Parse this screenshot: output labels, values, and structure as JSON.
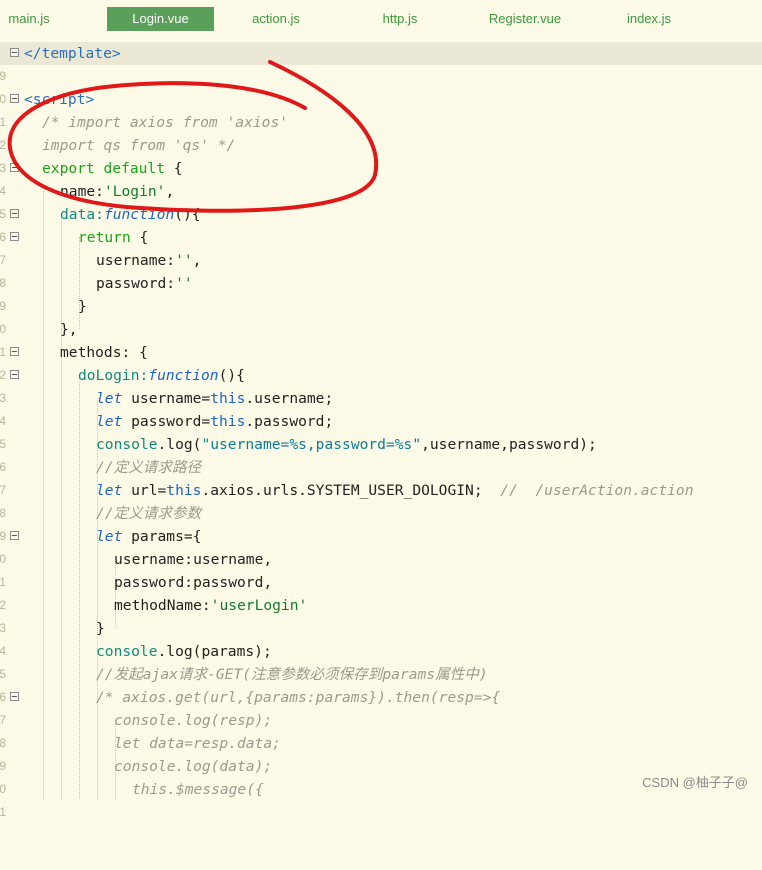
{
  "tabs": [
    {
      "label": "main.js"
    },
    {
      "label": "Login.vue"
    },
    {
      "label": "action.js"
    },
    {
      "label": "http.js"
    },
    {
      "label": "Register.vue"
    },
    {
      "label": "index.js"
    }
  ],
  "active_tab": "Login.vue",
  "line_numbers": [
    "9",
    "0",
    "1",
    "2",
    "3",
    "4",
    "5",
    "6",
    "7",
    "8",
    "9",
    "0",
    "1",
    "2",
    "3",
    "4",
    "5",
    "6",
    "7",
    "8",
    "9",
    "0",
    "1",
    "2",
    "3",
    "4",
    "5",
    "6",
    "7",
    "8",
    "9",
    "0",
    "1"
  ],
  "code": {
    "l0": "</template>",
    "l2a": "<script>",
    "l3": "/* import axios from 'axios'",
    "l4": "import qs from 'qs' */",
    "l5_kw": "export default",
    "l5_rest": " {",
    "l6_a": "name:",
    "l6_b": "'Login'",
    "l6_c": ",",
    "l7_a": "data:",
    "l7_b": "function",
    "l7_c": "(){",
    "l8_a": "return",
    "l8_b": " {",
    "l9_a": "username:",
    "l9_b": "''",
    "l9_c": ",",
    "l10_a": "password:",
    "l10_b": "''",
    "l11": "}",
    "l12": "},",
    "l13": "methods: {",
    "l14_a": "doLogin:",
    "l14_b": "function",
    "l14_c": "(){",
    "l15_a": "let",
    "l15_b": " username=",
    "l15_c": "this",
    "l15_d": ".username;",
    "l16_a": "let",
    "l16_b": " password=",
    "l16_c": "this",
    "l16_d": ".password;",
    "l17_a": "console",
    "l17_b": ".log(",
    "l17_c": "\"username=%s,password=%s\"",
    "l17_d": ",username,password);",
    "l18": "//定义请求路径",
    "l19_a": "let",
    "l19_b": " url=",
    "l19_c": "this",
    "l19_d": ".axios.urls.SYSTEM_USER_DOLOGIN;  ",
    "l19_e": "//  /userAction.action",
    "l20": "//定义请求参数",
    "l21_a": "let",
    "l21_b": " params={",
    "l22": "username:username,",
    "l23": "password:password,",
    "l24_a": "methodName:",
    "l24_b": "'userLogin'",
    "l25": "}",
    "l26_a": "console",
    "l26_b": ".log(params);",
    "l27": "//发起ajax请求-GET(注意参数必须保存到params属性中)",
    "l28": "/* axios.get(url,{params:params}).then(resp=>{",
    "l29": "console.log(resp);",
    "l30": "let data=resp.data;",
    "l31": "console.log(data);",
    "l32": "this.$message({"
  },
  "watermark": "CSDN @柚子子@",
  "colors": {
    "background": "#fdfbe8",
    "active_tab": "#5aa05a",
    "tab_text": "#3a9a3a",
    "annotation": "#e01818"
  }
}
